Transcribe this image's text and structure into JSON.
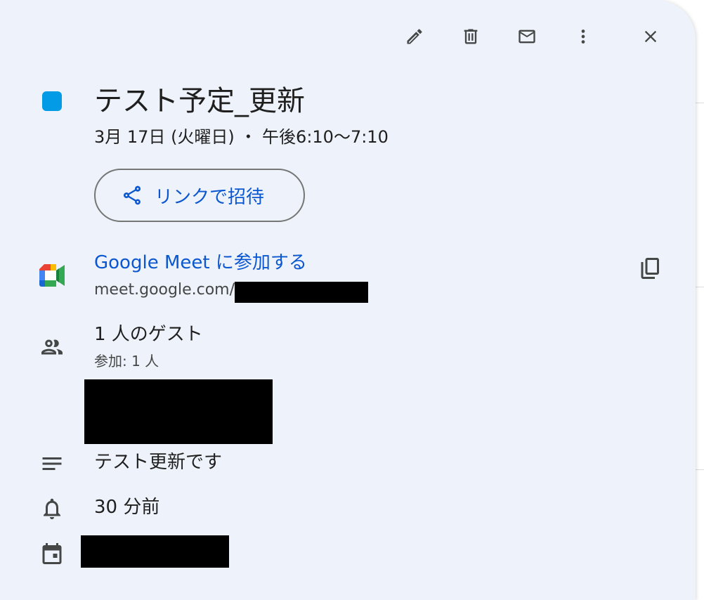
{
  "event": {
    "color": "#039be5",
    "title": "テスト予定_更新",
    "datetime": "3月 17日 (火曜日) ・ 午後6:10〜7:10"
  },
  "toolbar": {
    "edit_icon": "edit-pencil-icon",
    "delete_icon": "trash-icon",
    "email_icon": "mail-icon",
    "more_icon": "more-vert-icon",
    "close_icon": "close-icon"
  },
  "invite": {
    "label": "リンクで招待",
    "icon": "share-icon"
  },
  "meet": {
    "join_label": "Google Meet に参加する",
    "url": "meet.google.com/",
    "icon": "google-meet-logo",
    "copy_icon": "copy-icon"
  },
  "guests": {
    "count_label": "1 人のゲスト",
    "status_label": "参加: 1 人",
    "icon": "people-icon"
  },
  "description": {
    "text": "テスト更新です",
    "icon": "notes-icon"
  },
  "reminder": {
    "text": "30 分前",
    "icon": "bell-icon"
  },
  "calendar": {
    "icon": "calendar-event-icon"
  },
  "colors": {
    "link": "#0b57d0",
    "card_background": "#eef2fa"
  }
}
